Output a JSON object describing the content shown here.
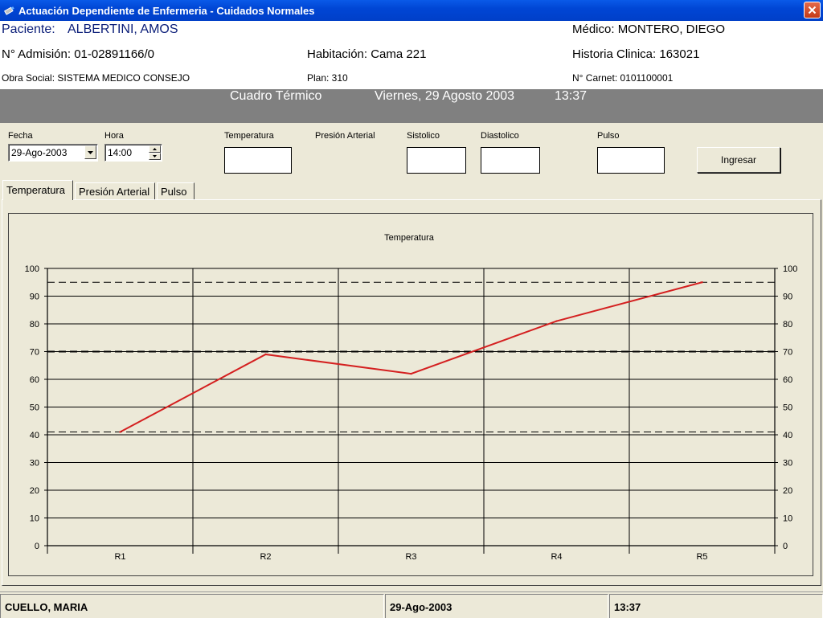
{
  "window": {
    "title": "Actuación Dependiente de Enfermeria - Cuidados Normales"
  },
  "patient": {
    "label": "Paciente:",
    "name": "ALBERTINI, AMOS",
    "admission": "N° Admisión: 01-02891166/0",
    "room": "Habitación: Cama 221",
    "doctor": "Médico:  MONTERO, DIEGO",
    "history": "Historia Clinica:  163021",
    "insurance": "Obra Social: SISTEMA MEDICO CONSEJO",
    "plan": "Plan: 310",
    "card": "N° Carnet: 0101100001"
  },
  "band": {
    "title": "Cuadro Térmico",
    "date": "Viernes, 29 Agosto 2003",
    "time": "13:37"
  },
  "form": {
    "fecha_label": "Fecha",
    "fecha_value": "29-Ago-2003",
    "hora_label": "Hora",
    "hora_value": "14:00",
    "temperatura_label": "Temperatura",
    "temperatura_value": "",
    "presion_label": "Presión Arterial",
    "sistolico_label": "Sistolico",
    "sistolico_value": "",
    "diastolico_label": "Diastolico",
    "diastolico_value": "",
    "pulso_label": "Pulso",
    "pulso_value": "",
    "submit_label": "Ingresar"
  },
  "tabs": [
    {
      "label": "Temperatura",
      "active": true
    },
    {
      "label": "Presión Arterial",
      "active": false
    },
    {
      "label": "Pulso",
      "active": false
    }
  ],
  "chart_data": {
    "type": "line",
    "title": "Temperatura",
    "categories": [
      "R1",
      "R2",
      "R3",
      "R4",
      "R5"
    ],
    "series": [
      {
        "values": [
          41,
          69,
          62,
          81,
          95
        ],
        "color": "#d42020"
      }
    ],
    "reference_lines": [
      {
        "value": 95,
        "style": "dashed"
      },
      {
        "value": 70,
        "style": "dashed-bold"
      },
      {
        "value": 41,
        "style": "dashed"
      }
    ],
    "ylim": [
      0,
      100
    ],
    "yticks": [
      0,
      10,
      20,
      30,
      40,
      50,
      60,
      70,
      80,
      90,
      100
    ],
    "grid": true,
    "secondary_y_axis": true,
    "xlabel": "",
    "ylabel": ""
  },
  "status": {
    "user": "CUELLO, MARIA",
    "date": "29-Ago-2003",
    "time": "13:37"
  },
  "icons": {
    "app": "app-icon",
    "close": "close-icon",
    "dropdown": "chevron-down-icon",
    "spin_up": "spin-up-icon",
    "spin_down": "spin-down-icon"
  }
}
